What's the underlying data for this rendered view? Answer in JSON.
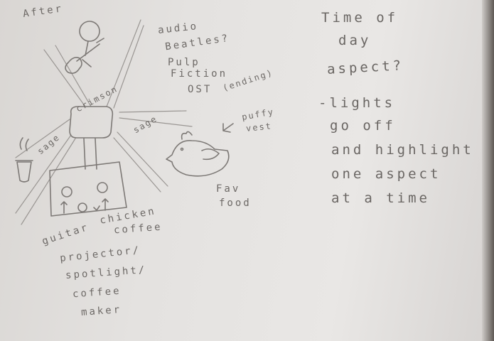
{
  "title_partial": "After",
  "labels": {
    "crimson": "crimson",
    "sage_left": "sage",
    "sage_right": "sage"
  },
  "audio_note": [
    "audio",
    "Beatles?",
    "Pulp",
    "Fiction",
    "OST"
  ],
  "audio_note_small": "(ending)",
  "vest_note": [
    "puffy",
    "vest"
  ],
  "food_note": [
    "Fav",
    "food"
  ],
  "bottom_note": [
    "guitar",
    "chicken",
    "coffee",
    "projector/",
    "spotlight/",
    "coffee",
    "maker"
  ],
  "right_note": [
    "Time of",
    "day",
    "aspect?",
    "-lights",
    "go off",
    "and highlight",
    "one aspect",
    "at a time"
  ]
}
